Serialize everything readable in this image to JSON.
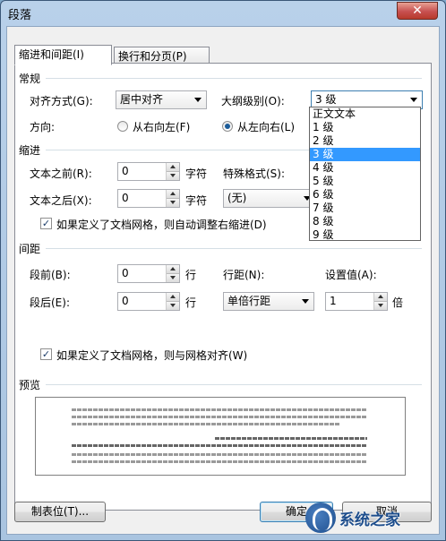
{
  "window": {
    "title": "段落",
    "close_glyph": "✕"
  },
  "tabs": [
    {
      "label": "缩进和间距(I)",
      "active": true
    },
    {
      "label": "换行和分页(P)",
      "active": false
    }
  ],
  "general": {
    "group_label": "常规",
    "alignment_label": "对齐方式(G):",
    "alignment_value": "居中对齐",
    "outline_label": "大纲级别(O):",
    "outline_value": "3 级",
    "direction_label": "方向:",
    "rtl_label": "从右向左(F)",
    "ltr_label": "从左向右(L)",
    "direction_selected": "ltr"
  },
  "outline_dropdown": {
    "options": [
      "正文文本",
      "1 级",
      "2 级",
      "3 级",
      "4 级",
      "5 级",
      "6 级",
      "7 级",
      "8 级",
      "9 级"
    ],
    "selected": "3 级"
  },
  "indent": {
    "group_label": "缩进",
    "before_label": "文本之前(R):",
    "before_value": "0",
    "before_unit": "字符",
    "after_label": "文本之后(X):",
    "after_value": "0",
    "after_unit": "字符",
    "special_label": "特殊格式(S):",
    "special_value": "(无)",
    "grid_check_label": "如果定义了文档网格，则自动调整右缩进(D)",
    "grid_check_checked": true
  },
  "spacing": {
    "group_label": "间距",
    "before_label": "段前(B):",
    "before_value": "0",
    "before_unit": "行",
    "after_label": "段后(E):",
    "after_value": "0",
    "after_unit": "行",
    "line_label": "行距(N):",
    "line_value": "单倍行距",
    "setting_label": "设置值(A):",
    "setting_value": "1",
    "setting_unit": "倍",
    "snap_check_label": "如果定义了文档网格，则与网格对齐(W)",
    "snap_check_checked": true
  },
  "preview": {
    "group_label": "预览"
  },
  "buttons": {
    "tabs_label": "制表位(T)...",
    "ok_label": "确定",
    "cancel_label": "取消"
  },
  "watermark": {
    "text": "系统之家"
  }
}
